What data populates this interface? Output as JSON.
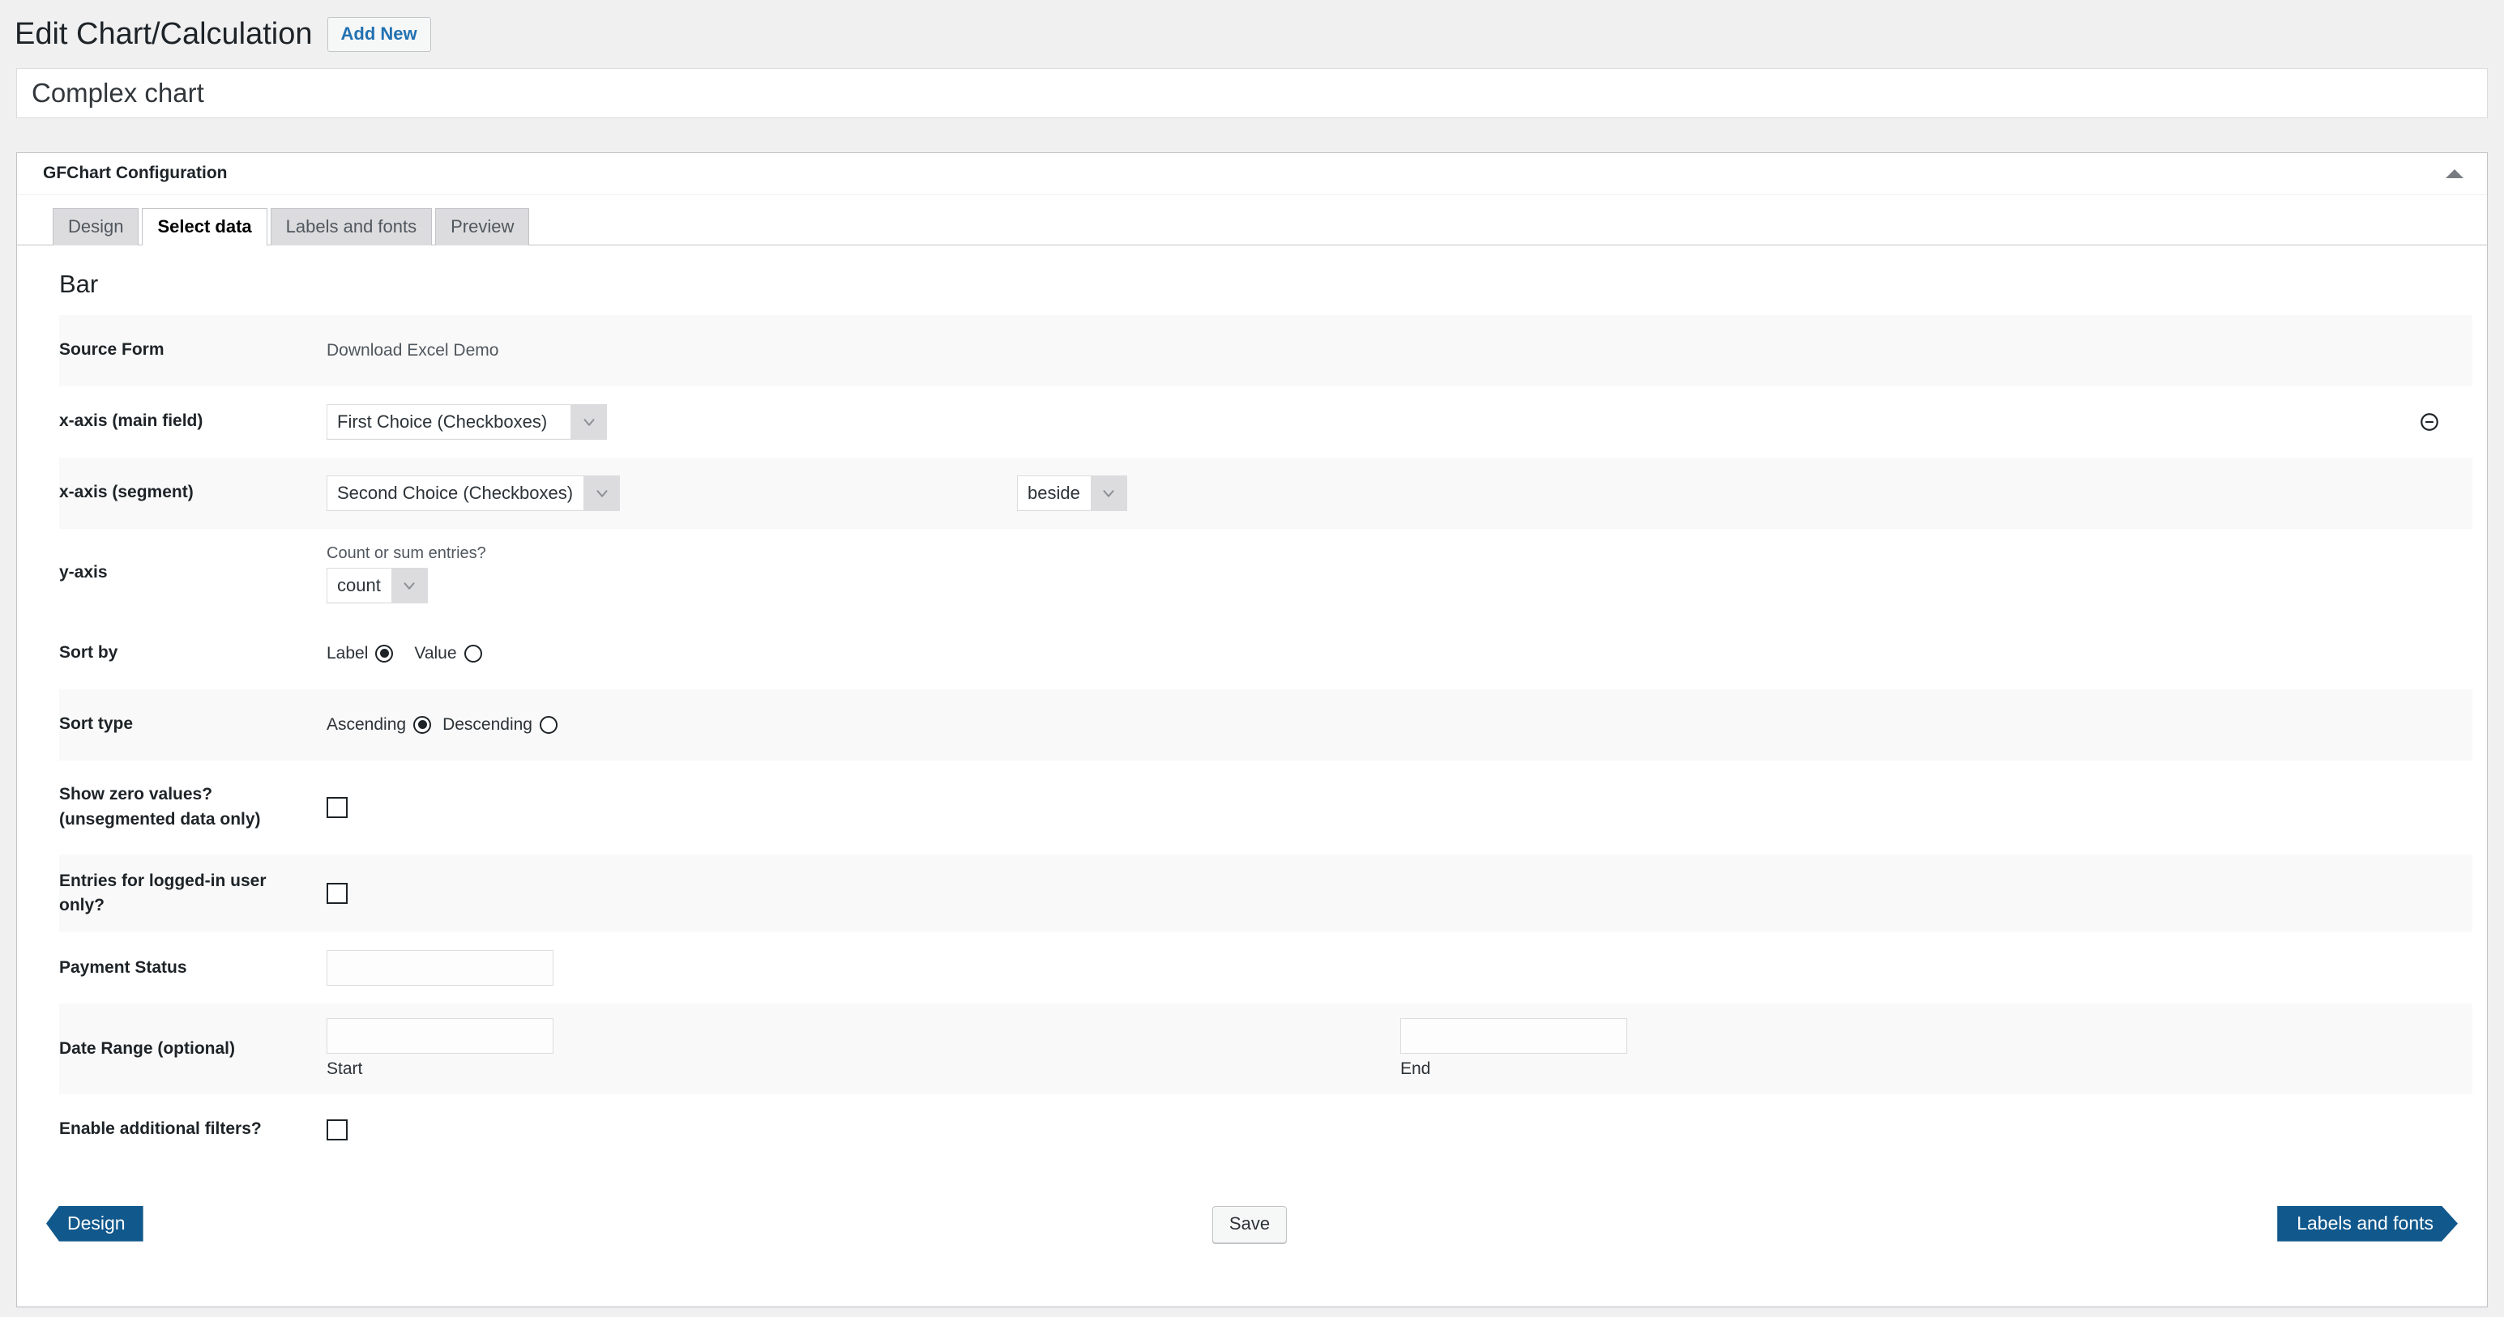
{
  "header": {
    "title": "Edit Chart/Calculation",
    "add_new_label": "Add New"
  },
  "chart_title": {
    "value": "Complex chart",
    "placeholder": "Add title"
  },
  "metabox": {
    "title": "GFChart Configuration",
    "collapse_icon": "triangle-up-icon"
  },
  "tabs": [
    {
      "label": "Design",
      "active": false
    },
    {
      "label": "Select data",
      "active": true
    },
    {
      "label": "Labels and fonts",
      "active": false
    },
    {
      "label": "Preview",
      "active": false
    }
  ],
  "chart_type_heading": "Bar",
  "fields": {
    "source_form": {
      "label": "Source Form",
      "value": "Download Excel Demo"
    },
    "x_axis_main": {
      "label": "x-axis (main field)",
      "value": "First Choice (Checkboxes)",
      "remove_icon": "minus-circle-icon"
    },
    "x_axis_segment": {
      "label": "x-axis (segment)",
      "value": "Second Choice (Checkboxes)",
      "mode_value": "beside"
    },
    "y_axis": {
      "label": "y-axis",
      "hint": "Count or sum entries?",
      "value": "count"
    },
    "sort_by": {
      "label": "Sort by",
      "options": [
        {
          "label": "Label",
          "checked": true
        },
        {
          "label": "Value",
          "checked": false
        }
      ]
    },
    "sort_type": {
      "label": "Sort type",
      "options": [
        {
          "label": "Ascending",
          "checked": true
        },
        {
          "label": "Descending",
          "checked": false
        }
      ]
    },
    "show_zero": {
      "label": "Show zero values? (unsegmented data only)",
      "checked": false
    },
    "logged_in_only": {
      "label": "Entries for logged-in user only?",
      "checked": false
    },
    "payment_status": {
      "label": "Payment Status",
      "value": "",
      "placeholder": ""
    },
    "date_range": {
      "label": "Date Range (optional)",
      "start_value": "",
      "start_placeholder": "",
      "start_sub_label": "Start",
      "end_value": "",
      "end_placeholder": "",
      "end_sub_label": "End"
    },
    "additional_filters": {
      "label": "Enable additional filters?",
      "checked": false
    }
  },
  "footer": {
    "prev_label": "Design",
    "save_label": "Save",
    "next_label": "Labels and fonts"
  },
  "colors": {
    "accent_blue": "#11588c",
    "link_blue": "#2271b1",
    "page_bg": "#f0f0f1",
    "stripe": "#f9f9f9"
  }
}
